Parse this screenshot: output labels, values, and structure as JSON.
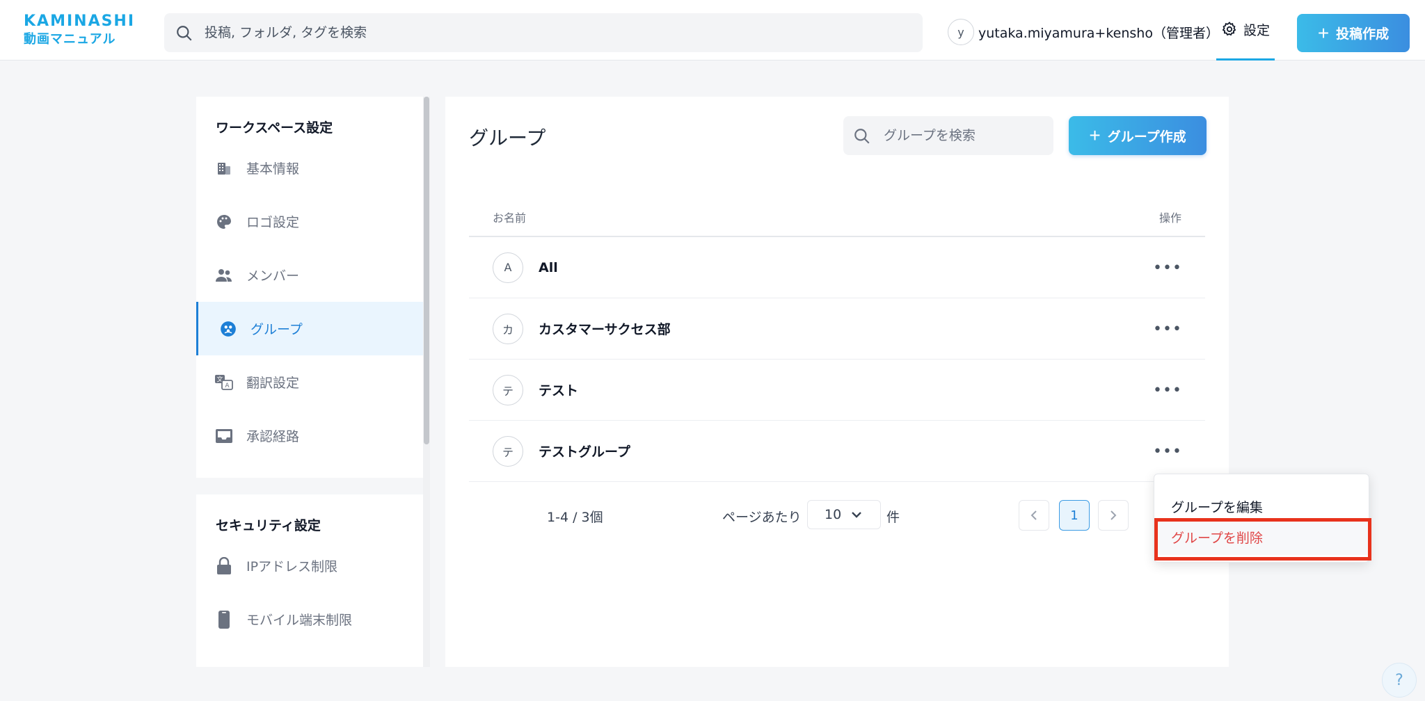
{
  "header": {
    "logo_top": "KAMINASHI",
    "logo_bottom": "動画マニュアル",
    "search_placeholder": "投稿, フォルダ, タグを検索",
    "user_initial": "y",
    "user_name": "yutaka.miyamura+kensho（管理者）",
    "settings_label": "設定",
    "post_button_label": "投稿作成"
  },
  "sidebar": {
    "workspace_title": "ワークスペース設定",
    "workspace_items": [
      {
        "label": "基本情報",
        "icon": "building-icon"
      },
      {
        "label": "ロゴ設定",
        "icon": "palette-icon"
      },
      {
        "label": "メンバー",
        "icon": "members-icon"
      },
      {
        "label": "グループ",
        "icon": "group-icon",
        "active": true
      },
      {
        "label": "翻訳設定",
        "icon": "translate-icon"
      },
      {
        "label": "承認経路",
        "icon": "inbox-icon"
      }
    ],
    "security_title": "セキュリティ設定",
    "security_items": [
      {
        "label": "IPアドレス制限",
        "icon": "lock-icon"
      },
      {
        "label": "モバイル端末制限",
        "icon": "mobile-icon"
      }
    ]
  },
  "main": {
    "title": "グループ",
    "search_placeholder": "グループを検索",
    "create_button_label": "グループ作成",
    "columns": {
      "name": "お名前",
      "actions": "操作"
    },
    "rows": [
      {
        "initial": "A",
        "name": "All"
      },
      {
        "initial": "カ",
        "name": "カスタマーサクセス部"
      },
      {
        "initial": "テ",
        "name": "テスト"
      },
      {
        "initial": "テ",
        "name": "テストグループ"
      }
    ],
    "more_glyph": "•••",
    "pagination": {
      "count_text": "1-4 / 3個",
      "per_page_label": "ページあたり",
      "per_page_value": "10",
      "unit_label": "件",
      "current_page": "1"
    }
  },
  "context_menu": {
    "edit_label": "グループを編集",
    "delete_label": "グループを削除"
  },
  "help_label": "?",
  "colors": {
    "brand": "#1ba7e4",
    "accent": "#1d7fd6",
    "danger": "#e04646",
    "highlight_border": "#e8321c"
  }
}
